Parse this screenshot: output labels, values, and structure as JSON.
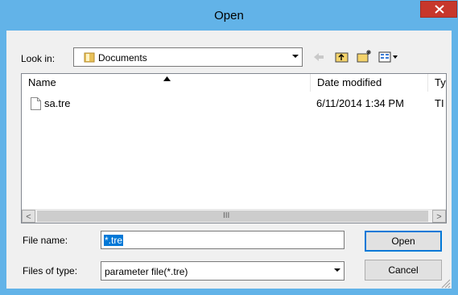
{
  "window": {
    "title": "Open"
  },
  "lookin": {
    "label": "Look in:",
    "value": "Documents"
  },
  "list": {
    "columns": [
      "Name",
      "Date modified",
      "Ty"
    ],
    "files": [
      {
        "name": "sa.tre",
        "date": "6/11/2014 1:34 PM",
        "type": "TI"
      }
    ],
    "scroll_thumb_glyph": "III",
    "scroll_left_glyph": "<",
    "scroll_right_glyph": ">"
  },
  "filename": {
    "label": "File name:",
    "value": "*.tre"
  },
  "filetype": {
    "label": "Files of type:",
    "value": "parameter file(*.tre)"
  },
  "buttons": {
    "open": "Open",
    "cancel": "Cancel"
  },
  "colors": {
    "title_bar": "#62b3e8",
    "close_button": "#c7372b",
    "selection": "#0078d7"
  }
}
